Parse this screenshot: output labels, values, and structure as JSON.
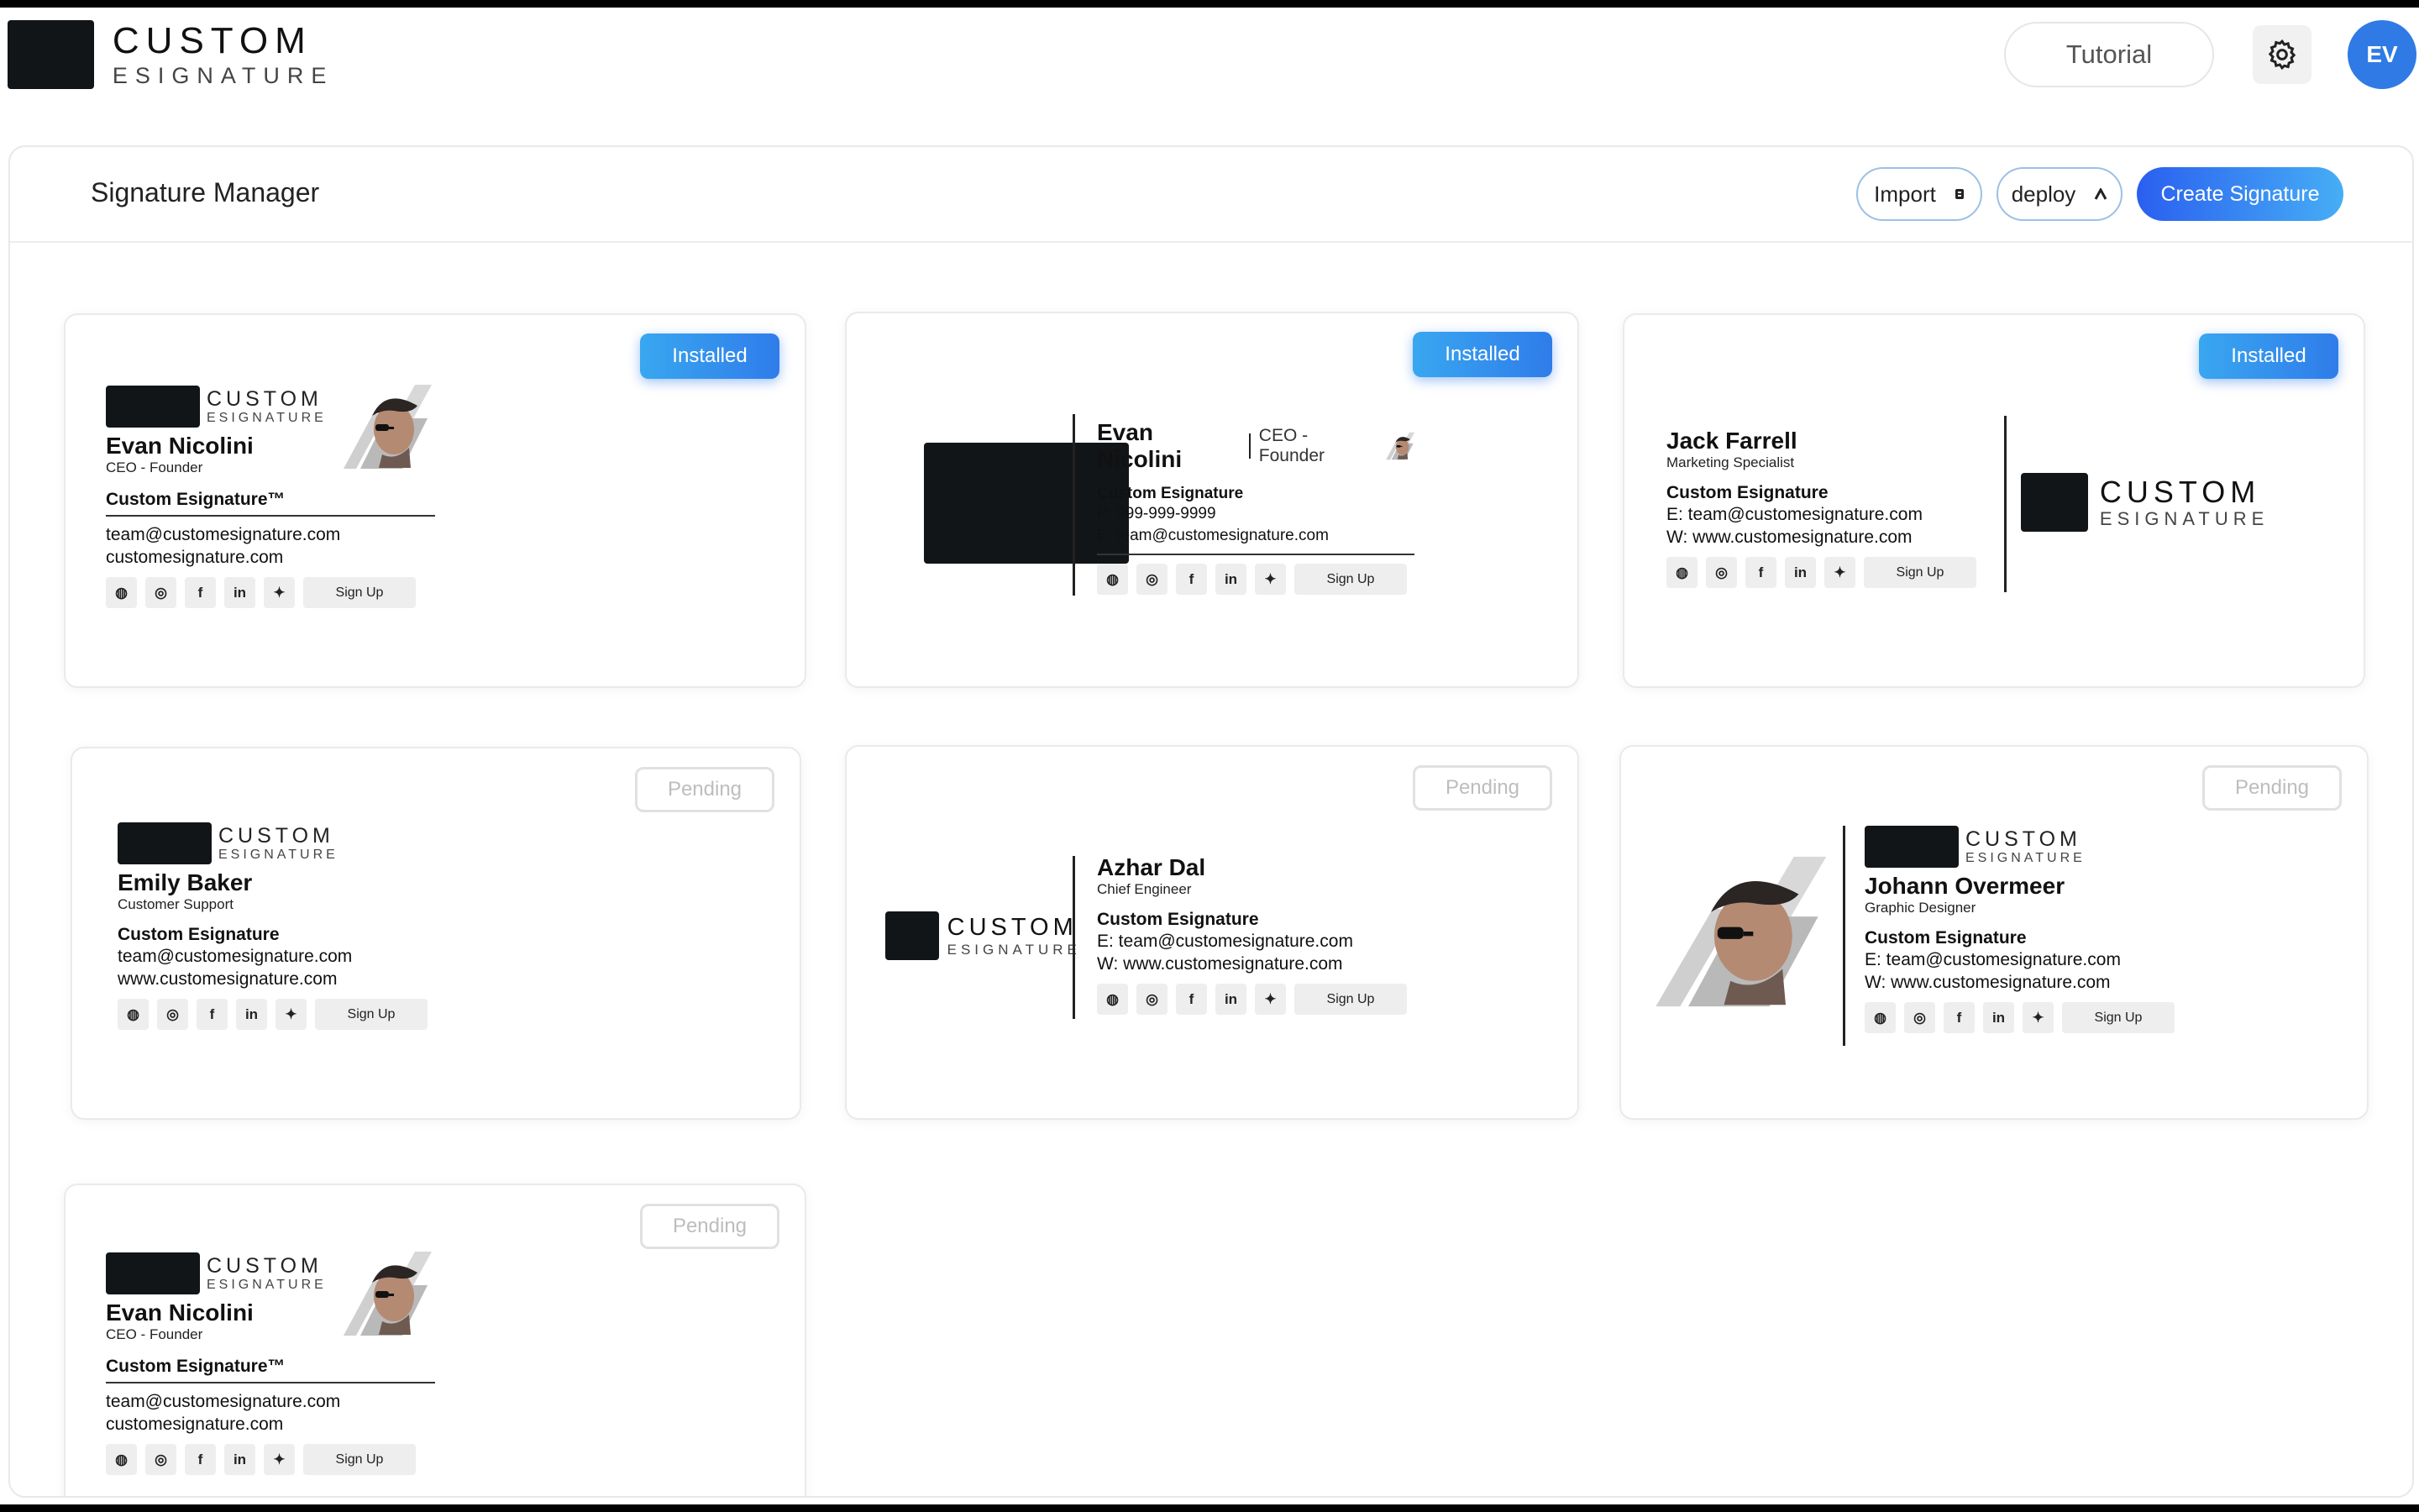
{
  "app": {
    "logo_line1": "CUSTOM",
    "logo_line2": "ESIGNATURE"
  },
  "header": {
    "tutorial_label": "Tutorial",
    "settings_icon": "gear-icon",
    "avatar_initials": "EV"
  },
  "panel": {
    "title": "Signature Manager",
    "import_label": "Import",
    "deploy_label": "deploy",
    "create_label": "Create Signature"
  },
  "colors": {
    "primary": "#2f7ae5",
    "accent": "#57c6e8",
    "pending": "#bdbdbd"
  },
  "signature_common": {
    "logo_line1": "CUSTOM",
    "logo_line2": "ESIGNATURE",
    "signup_label": "Sign Up",
    "social_icons": [
      "globe-icon",
      "instagram-icon",
      "facebook-icon",
      "linkedin-icon",
      "twitter-icon"
    ]
  },
  "cards": [
    {
      "status": "Installed",
      "name": "Evan Nicolini",
      "role": "CEO - Founder",
      "company": "Custom Esignature™",
      "line1": "team@customesignature.com",
      "line2": "customesignature.com"
    },
    {
      "status": "Installed",
      "name": "Evan Nicolini",
      "role": "CEO - Founder",
      "company": "Custom Esignature",
      "line1": "P: 999-999-9999",
      "line2": "E: team@customesignature.com"
    },
    {
      "status": "Installed",
      "name": "Jack Farrell",
      "role": "Marketing Specialist",
      "company": "Custom Esignature",
      "line1": "E: team@customesignature.com",
      "line2": "W: www.customesignature.com"
    },
    {
      "status": "Pending",
      "name": "Emily Baker",
      "role": "Customer Support",
      "company": "Custom Esignature",
      "line1": "team@customesignature.com",
      "line2": "www.customesignature.com"
    },
    {
      "status": "Pending",
      "name": "Azhar Dal",
      "role": "Chief Engineer",
      "company": "Custom Esignature",
      "line1": "E: team@customesignature.com",
      "line2": "W: www.customesignature.com"
    },
    {
      "status": "Pending",
      "name": "Johann Overmeer",
      "role": "Graphic Designer",
      "company": "Custom Esignature",
      "line1": "E: team@customesignature.com",
      "line2": "W: www.customesignature.com"
    },
    {
      "status": "Pending",
      "name": "Evan Nicolini",
      "role": "CEO - Founder",
      "company": "Custom Esignature™",
      "line1": "team@customesignature.com",
      "line2": "customesignature.com"
    }
  ]
}
